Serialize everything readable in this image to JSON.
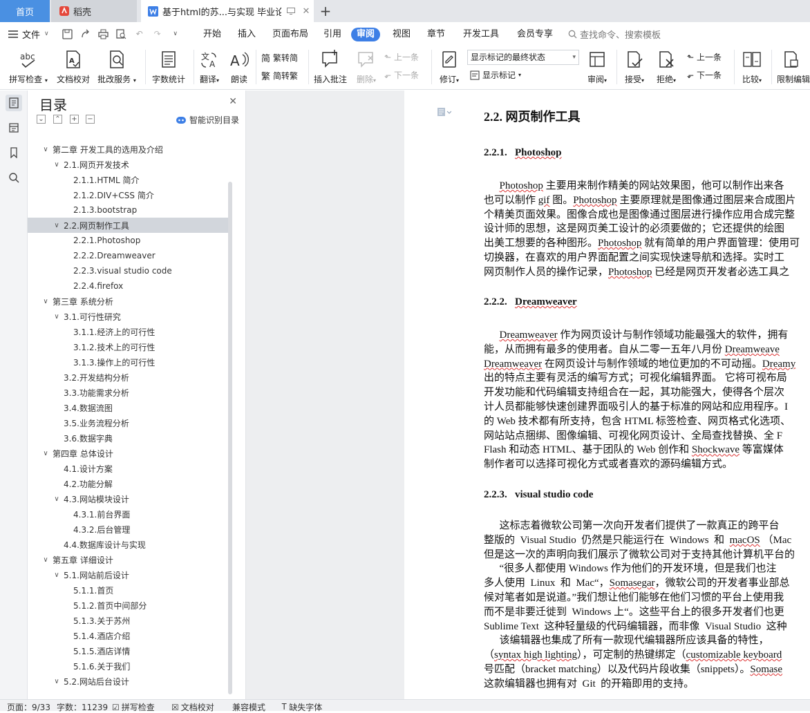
{
  "tabs": {
    "home": "首页",
    "daoke": "稻壳",
    "doc": "基于html的苏...与实现 毕业论文"
  },
  "menu": {
    "file": "文件",
    "items": [
      "开始",
      "插入",
      "页面布局",
      "引用",
      "审阅",
      "视图",
      "章节",
      "开发工具",
      "会员专享"
    ],
    "active": "审阅",
    "search": "查找命令、搜索模板"
  },
  "ribbon": {
    "spellcheck": "拼写检查",
    "proofread": "文档校对",
    "annotate_service": "批改服务",
    "word_count": "字数统计",
    "translate": "翻译",
    "read_aloud": "朗读",
    "trad_to_simp": "繁转简",
    "simp_to_trad": "简转繁",
    "insert_comment": "插入批注",
    "delete": "删除",
    "prev_comment": "上一条",
    "next_comment": "下一条",
    "track_changes": "修订",
    "markup_state": "显示标记的最终状态",
    "show_markup": "显示标记",
    "review": "审阅",
    "accept": "接受",
    "reject": "拒绝",
    "prev_change": "上一条",
    "next_change": "下一条",
    "compare": "比较",
    "restrict_edit": "限制编辑"
  },
  "toc": {
    "title": "目录",
    "smart": "智能识别目录",
    "items": [
      {
        "label": "第二章 开发工具的选用及介绍",
        "level": 1,
        "chev": "down"
      },
      {
        "label": "2.1.网页开发技术",
        "level": 2,
        "chev": "down"
      },
      {
        "label": "2.1.1.HTML 简介",
        "level": 3
      },
      {
        "label": "2.1.2.DIV+CSS 简介",
        "level": 3
      },
      {
        "label": "2.1.3.bootstrap",
        "level": 3
      },
      {
        "label": "2.2.网页制作工具",
        "level": 2,
        "chev": "down",
        "selected": true
      },
      {
        "label": "2.2.1.Photoshop",
        "level": 3
      },
      {
        "label": "2.2.2.Dreamweaver",
        "level": 3
      },
      {
        "label": "2.2.3.visual studio code",
        "level": 3
      },
      {
        "label": "2.2.4.firefox",
        "level": 3
      },
      {
        "label": "第三章  系统分析",
        "level": 1,
        "chev": "down"
      },
      {
        "label": "3.1.可行性研究",
        "level": 2,
        "chev": "down"
      },
      {
        "label": "3.1.1.经济上的可行性",
        "level": 3
      },
      {
        "label": "3.1.2.技术上的可行性",
        "level": 3
      },
      {
        "label": "3.1.3.操作上的可行性",
        "level": 3
      },
      {
        "label": "3.2.开发结构分析",
        "level": 2
      },
      {
        "label": "3.3.功能需求分析",
        "level": 2
      },
      {
        "label": "3.4.数据流图",
        "level": 2
      },
      {
        "label": "3.5.业务流程分析",
        "level": 2
      },
      {
        "label": "3.6.数据字典",
        "level": 2
      },
      {
        "label": "第四章  总体设计",
        "level": 1,
        "chev": "down"
      },
      {
        "label": "4.1.设计方案",
        "level": 2
      },
      {
        "label": "4.2.功能分解",
        "level": 2
      },
      {
        "label": "4.3.网站模块设计",
        "level": 2,
        "chev": "down"
      },
      {
        "label": "4.3.1.前台界面",
        "level": 3
      },
      {
        "label": "4.3.2.后台管理",
        "level": 3
      },
      {
        "label": "4.4.数据库设计与实现",
        "level": 2
      },
      {
        "label": "第五章  详细设计",
        "level": 1,
        "chev": "down"
      },
      {
        "label": "5.1.网站前后设计",
        "level": 2,
        "chev": "down"
      },
      {
        "label": "5.1.1.首页",
        "level": 3
      },
      {
        "label": "5.1.2.首页中间部分",
        "level": 3
      },
      {
        "label": "5.1.3.关于苏州",
        "level": 3
      },
      {
        "label": "5.1.4.酒店介绍",
        "level": 3
      },
      {
        "label": "5.1.5.酒店详情",
        "level": 3
      },
      {
        "label": "5.1.6.关于我们",
        "level": 3
      },
      {
        "label": "5.2.网站后台设计",
        "level": 2,
        "chev": "down"
      }
    ]
  },
  "doc": {
    "h2": "2.2.  网页制作工具",
    "h_ps_num": "2.2.1.",
    "h_ps": "Photoshop",
    "h_dw_num": "2.2.2.",
    "h_dw": "Dreamweaver",
    "h_vs_num": "2.2.3.",
    "h_vs": "visual studio code",
    "p1": [
      [
        [
          "      ",
          ""
        ],
        [
          "Photoshop",
          "sq"
        ],
        [
          " 主要用来制作精美的网站效果图，他可以制作出来各",
          ""
        ]
      ],
      [
        [
          "也可以制作 ",
          ""
        ],
        [
          "gif",
          "sq"
        ],
        [
          " 图。",
          ""
        ],
        [
          "Photoshop",
          "sq"
        ],
        [
          " 主要原理就是图像通过图层来合成图片",
          ""
        ]
      ],
      [
        [
          "个精美页面效果。图像合成也是图像通过图层进行操作应用合成完整",
          ""
        ]
      ],
      [
        [
          "设计师的思想，这是网页美工设计的必须要做的；它还提供的绘图",
          ""
        ]
      ],
      [
        [
          "出美工想要的各种图形。",
          ""
        ],
        [
          "Photoshop",
          "sq"
        ],
        [
          " 就有简单的用户界面管理：使用可",
          ""
        ]
      ],
      [
        [
          "切换器，在喜欢的用户界面配置之间实现快速导航和选择。实时工",
          ""
        ]
      ],
      [
        [
          "网页制作人员的操作记录，",
          ""
        ],
        [
          "Photoshop",
          "sq"
        ],
        [
          " 已经是网页开发者必选工具之",
          ""
        ]
      ]
    ],
    "p2": [
      [
        [
          "      ",
          ""
        ],
        [
          "Dreamweaver",
          "sq"
        ],
        [
          " 作为网页设计与制作领域功能最强大的软件，拥有",
          ""
        ]
      ],
      [
        [
          "能，从而拥有最多的使用者。自从二零一五年八月份 ",
          ""
        ],
        [
          "Dreamweave",
          "sq"
        ]
      ],
      [
        [
          "Dreamweaver",
          "sq"
        ],
        [
          " 在网页设计与制作领域的地位更加的不可动摇。",
          ""
        ],
        [
          "Dreamy",
          "sq"
        ]
      ],
      [
        [
          "出的特点主要有灵活的编写方式；可视化编辑界面。 它将可视布局",
          ""
        ]
      ],
      [
        [
          "开发功能和代码编辑支持组合在一起，其功能强大，使得各个层次",
          ""
        ]
      ],
      [
        [
          "计人员都能够快速创建界面吸引人的基于标准的网站和应用程序。I",
          ""
        ]
      ],
      [
        [
          "的 Web 技术都有所支持，包含 HTML 标签检查、网页格式化选项、",
          ""
        ]
      ],
      [
        [
          "网站站点捆绑、图像编辑、可视化网页设计、全局查找替换、全 F",
          ""
        ]
      ],
      [
        [
          "Flash 和动态 HTML、基于团队的 Web 创作和 ",
          ""
        ],
        [
          "Shockwave",
          "sq"
        ],
        [
          " 等富媒体",
          ""
        ]
      ],
      [
        [
          "制作者可以选择可视化方式或者喜欢的源码编辑方式。",
          ""
        ]
      ]
    ],
    "p3": [
      [
        [
          "      这标志着微软公司第一次向开发者们提供了一款真正的跨平台",
          ""
        ]
      ],
      [
        [
          "整版的  Visual Studio  仍然是只能运行在  Windows  和  ",
          ""
        ],
        [
          "macOS",
          "sq"
        ],
        [
          " （Mac",
          ""
        ]
      ],
      [
        [
          "但是这一次的声明向我们展示了微软公司对于支持其他计算机平台的",
          ""
        ]
      ],
      [
        [
          "      “很多人都使用 Windows 作为他们的开发环境，但是我们也注",
          ""
        ]
      ],
      [
        [
          "多人使用  Linux  和  Mac“，",
          ""
        ],
        [
          "Somasegar",
          "sq"
        ],
        [
          "，微软公司的开发者事业部总",
          ""
        ]
      ],
      [
        [
          "候对笔者如是说道。”我们想让他们能够在他们习惯的平台上使用我",
          ""
        ]
      ],
      [
        [
          "而不是非要迁徙到  Windows 上“。这些平台上的很多开发者们也更",
          ""
        ]
      ],
      [
        [
          "Sublime Text  这种轻量级的代码编辑器，而非像  Visual Studio  这种",
          ""
        ]
      ],
      [
        [
          "      该编辑器也集成了所有一款现代编辑器所应该具备的特性，",
          ""
        ]
      ],
      [
        [
          "（",
          ""
        ],
        [
          "syntax high lighting",
          "sq"
        ],
        [
          "），可定制的热键绑定（",
          ""
        ],
        [
          "customizable keyboard",
          "sq"
        ]
      ],
      [
        [
          "号匹配（bracket matching）以及代码片段收集（snippets）。",
          ""
        ],
        [
          "Somase",
          "sq"
        ]
      ],
      [
        [
          "这款编辑器也拥有对  Git  的开箱即用的支持。",
          ""
        ]
      ]
    ]
  },
  "status": {
    "page": "页面：9/33",
    "words": "字数：11239",
    "spell": "拼写检查",
    "proof": "文档校对",
    "compat": "兼容模式",
    "missing_font": "缺失字体"
  }
}
